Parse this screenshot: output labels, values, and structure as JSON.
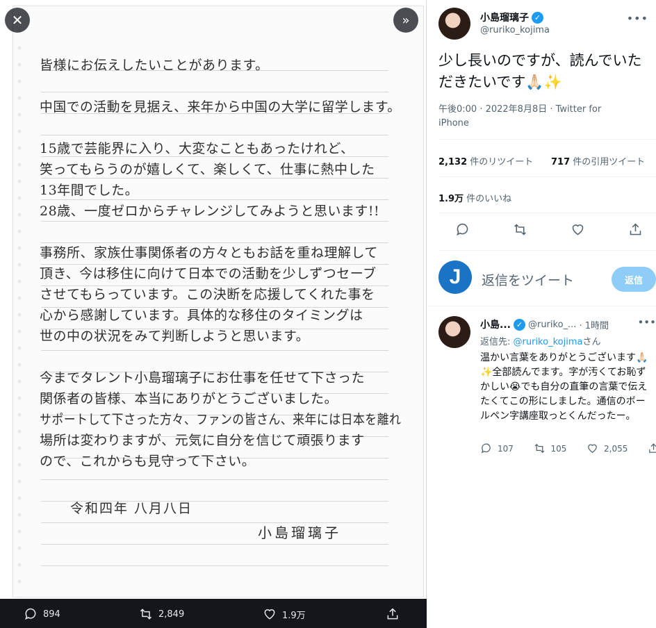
{
  "viewer": {
    "letter_lines": [
      "皆様にお伝えしたいことがあります。",
      "",
      "中国での活動を見据え、来年から中国の大学に留学します。",
      "",
      "15歳で芸能界に入り、大変なこともあったけれど、",
      "笑ってもらうのが嬉しくて、楽しくて、仕事に熱中した",
      "13年間でした。",
      "28歳、一度ゼロからチャレンジしてみようと思います!!",
      "",
      "事務所、家族仕事関係者の方々ともお話を重ね理解して",
      "頂き、今は移住に向けて日本での活動を少しずつセーブ",
      "させてもらっています。この決断を応援してくれた事を",
      "心から感謝しています。具体的な移住のタイミングは",
      "世の中の状況をみて判断しようと思います。",
      "",
      "今までタレント小島瑠璃子にお仕事を任せて下さった",
      "関係者の皆様、本当にありがとうございました。",
      "サポートして下さった方々、ファンの皆さん、来年には日本を離れ",
      "場所は変わりますが、元気に自分を信じて頑張ります",
      "ので、これからも見守って下さい。"
    ],
    "letter_date": "令和四年 八月八日",
    "letter_signature": "小島瑠璃子",
    "bar": {
      "replies": "894",
      "retweets": "2,849",
      "likes": "1.9万"
    }
  },
  "tweet": {
    "name": "小島瑠璃子",
    "handle": "@ruriko_kojima",
    "text": "少し長いのですが、読んでいただきたいです🙏🏻✨",
    "meta_time": "午後0:00 · 2022年8月8日 · ",
    "meta_source": "Twitter for iPhone",
    "retweets_count": "2,132",
    "retweets_label": " 件のリツイート",
    "quotes_count": "717",
    "quotes_label": " 件の引用ツイート",
    "likes_count": "1.9万",
    "likes_label": " 件のいいね"
  },
  "reply_composer": {
    "placeholder": "返信をツイート",
    "button": "返信",
    "avatar_letter": "J"
  },
  "reply": {
    "name": "小島...",
    "handle": "@ruriko_...",
    "time": "· 1時間",
    "to_label": "返信先: ",
    "to_handle": "@ruriko_kojima",
    "to_suffix": "さん",
    "text": "温かい言葉をありがとうございます🙏🏻✨全部読んでます。字が汚くてお恥ずかしい😭でも自分の直筆の言葉で伝えたくてこの形にしました。通信のボールペン字講座取っとくんだったー。",
    "replies": "107",
    "retweets": "105",
    "likes": "2,055"
  }
}
